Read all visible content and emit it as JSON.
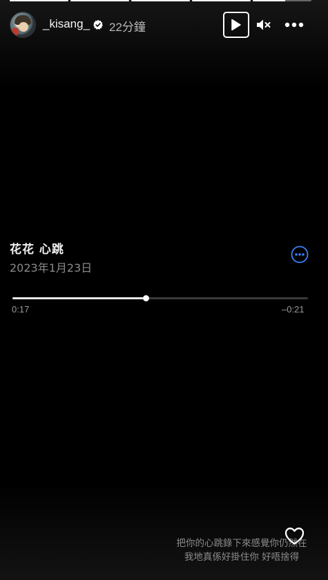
{
  "story": {
    "progress_segments": [
      1,
      1,
      1,
      1,
      0.55
    ]
  },
  "header": {
    "username": "_kisang_",
    "verified_icon": "verified-badge-icon",
    "timestamp": "22分鐘",
    "play_icon": "play-icon",
    "mute_icon": "speaker-muted-icon",
    "more_icon": "more-horizontal-icon"
  },
  "audio": {
    "title": "花花 心跳",
    "date": "2023年1月23日",
    "options_icon": "more-circle-icon",
    "elapsed": "0:17",
    "remaining": "–0:21",
    "progress": 0.45
  },
  "footer": {
    "caption_lines": [
      "把你的心跳錄下來感覺你仍然在",
      "我地真係好掛住你 好唔捨得"
    ],
    "like_icon": "heart-icon"
  },
  "colors": {
    "background": "#000000",
    "accent_blue": "#3a82f7",
    "text_secondary": "#8a8a8a"
  }
}
